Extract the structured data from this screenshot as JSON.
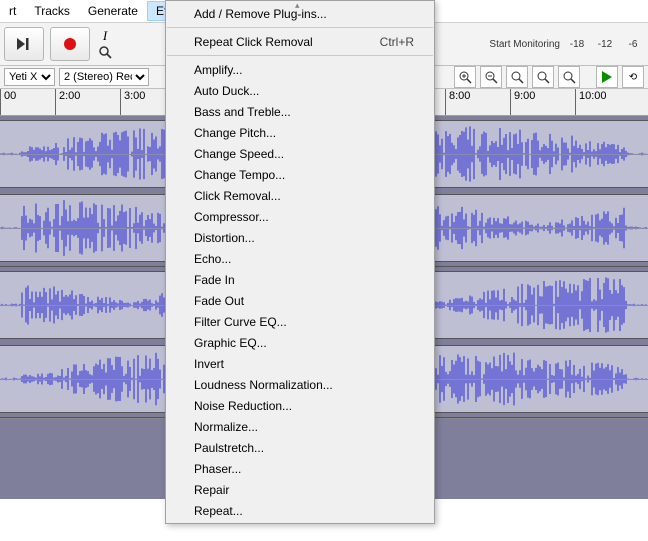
{
  "menubar": {
    "items": [
      "rt",
      "Tracks",
      "Generate",
      "Effect"
    ],
    "active_index": 3
  },
  "toolbar": {
    "skip_end_icon": "▶|",
    "record_icon": "●",
    "tool_ibeam": "I",
    "tool_search": "🔍",
    "start_monitoring": "Start Monitoring",
    "levels": [
      "-18",
      "-12",
      "-6"
    ]
  },
  "zoom_icons": [
    "⊕",
    "⊖",
    "⤧",
    "⤦",
    "⤢"
  ],
  "device_row": {
    "device": "Yeti X",
    "channels": "2 (Stereo) Rec"
  },
  "ruler": {
    "ticks_left": [
      "00",
      "2:00",
      "3:00"
    ],
    "ticks_right": [
      "8:00",
      "9:00",
      "10:00"
    ]
  },
  "effect_menu": {
    "top": "Add / Remove Plug-ins...",
    "repeat": {
      "label": "Repeat Click Removal",
      "shortcut": "Ctrl+R"
    },
    "items": [
      "Amplify...",
      "Auto Duck...",
      "Bass and Treble...",
      "Change Pitch...",
      "Change Speed...",
      "Change Tempo...",
      "Click Removal...",
      "Compressor...",
      "Distortion...",
      "Echo...",
      "Fade In",
      "Fade Out",
      "Filter Curve EQ...",
      "Graphic EQ...",
      "Invert",
      "Loudness Normalization...",
      "Noise Reduction...",
      "Normalize...",
      "Paulstretch...",
      "Phaser...",
      "Repair",
      "Repeat..."
    ]
  }
}
